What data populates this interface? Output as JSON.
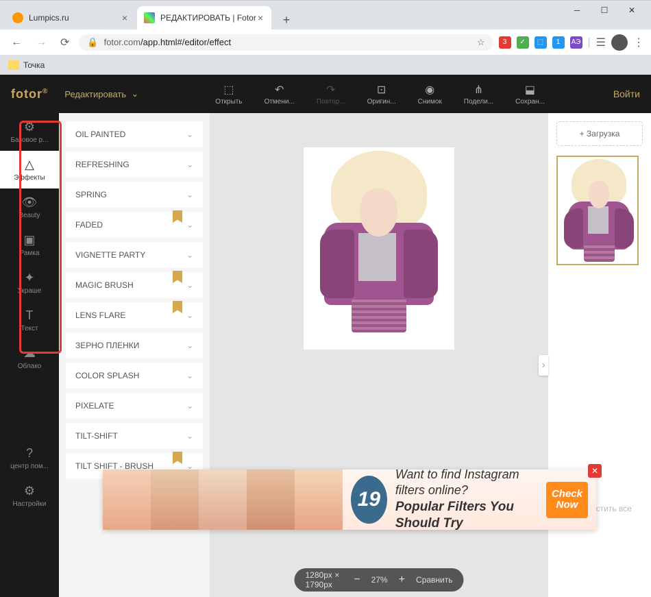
{
  "browser": {
    "tabs": [
      {
        "title": "Lumpics.ru",
        "favicon_color": "#ff9800",
        "active": false
      },
      {
        "title": "РЕДАКТИРОВАТЬ | Fotor",
        "favicon_color": "#ffcc00",
        "active": true
      }
    ],
    "url_host": "fotor.com",
    "url_path": "/app.html#/editor/effect",
    "bookmark": "Точка"
  },
  "header": {
    "logo": "fotor",
    "edit_label": "Редактировать",
    "toolbar": [
      {
        "label": "Открыть",
        "icon": "⬚"
      },
      {
        "label": "Отмени...",
        "icon": "↶"
      },
      {
        "label": "Повтор...",
        "icon": "↷",
        "disabled": true
      },
      {
        "label": "Оригин...",
        "icon": "⊡"
      },
      {
        "label": "Снимок",
        "icon": "◉"
      },
      {
        "label": "Подели...",
        "icon": "⋔"
      },
      {
        "label": "Сохран...",
        "icon": "⬓"
      }
    ],
    "login": "Войти"
  },
  "sidebar": {
    "items": [
      {
        "label": "Базовое р...",
        "icon": "⚙"
      },
      {
        "label": "Эффекты",
        "icon": "△",
        "active": true
      },
      {
        "label": "Beauty",
        "icon": "👁"
      },
      {
        "label": "Рамка",
        "icon": "▣"
      },
      {
        "label": "Украше",
        "icon": "✦"
      },
      {
        "label": "Текст",
        "icon": "T"
      },
      {
        "label": "Облако",
        "icon": "☁"
      }
    ],
    "bottom": [
      {
        "label": "центр пом...",
        "icon": "?"
      },
      {
        "label": "Настройки",
        "icon": "⚙"
      }
    ]
  },
  "effects": [
    {
      "name": "OIL PAINTED",
      "premium": false
    },
    {
      "name": "REFRESHING",
      "premium": false
    },
    {
      "name": "SPRING",
      "premium": false
    },
    {
      "name": "FADED",
      "premium": true
    },
    {
      "name": "VIGNETTE PARTY",
      "premium": false
    },
    {
      "name": "MAGIC BRUSH",
      "premium": true
    },
    {
      "name": "LENS FLARE",
      "premium": true
    },
    {
      "name": "ЗЕРНО ПЛЕНКИ",
      "premium": false
    },
    {
      "name": "COLOR SPLASH",
      "premium": false
    },
    {
      "name": "PIXELATE",
      "premium": false
    },
    {
      "name": "TILT-SHIFT",
      "premium": false
    },
    {
      "name": "TILT SHIFT - BRUSH",
      "premium": true
    }
  ],
  "canvas": {
    "dimensions": "1280px × 1790px",
    "zoom": "27%",
    "compare": "Сравнить"
  },
  "right": {
    "upload": "Загрузка",
    "clear": "Очистить все"
  },
  "ad": {
    "number": "19",
    "line1": "Want to find Instagram filters online?",
    "line2": "Popular Filters You Should Try",
    "cta1": "Check",
    "cta2": "Now"
  }
}
